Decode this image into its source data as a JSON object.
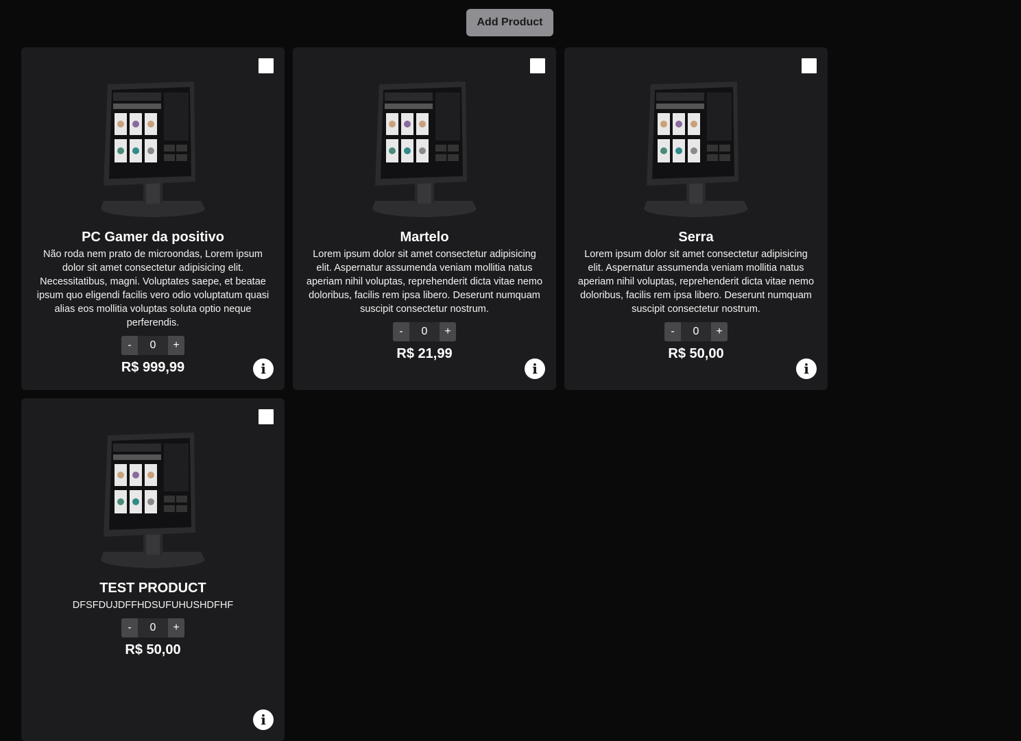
{
  "toolbar": {
    "add_label": "Add Product"
  },
  "products": [
    {
      "name": "PC Gamer da positivo",
      "description": "Não roda nem prato de microondas, Lorem ipsum dolor sit amet consectetur adipisicing elit. Necessitatibus, magni. Voluptates saepe, et beatae ipsum quo eligendi facilis vero odio voluptatum quasi alias eos mollitia voluptas soluta optio neque perferendis.",
      "quantity": "0",
      "price": "R$ 999,99",
      "minus": "-",
      "plus": "+",
      "info": "i"
    },
    {
      "name": "Martelo",
      "description": "Lorem ipsum dolor sit amet consectetur adipisicing elit. Aspernatur assumenda veniam mollitia natus aperiam nihil voluptas, reprehenderit dicta vitae nemo doloribus, facilis rem ipsa libero. Deserunt numquam suscipit consectetur nostrum.",
      "quantity": "0",
      "price": "R$ 21,99",
      "minus": "-",
      "plus": "+",
      "info": "i"
    },
    {
      "name": "Serra",
      "description": "Lorem ipsum dolor sit amet consectetur adipisicing elit. Aspernatur assumenda veniam mollitia natus aperiam nihil voluptas, reprehenderit dicta vitae nemo doloribus, facilis rem ipsa libero. Deserunt numquam suscipit consectetur nostrum.",
      "quantity": "0",
      "price": "R$ 50,00",
      "minus": "-",
      "plus": "+",
      "info": "i"
    },
    {
      "name": "TEST PRODUCT",
      "description": "DFSFDUJDFFHDSUFUHUSHDFHF",
      "quantity": "0",
      "price": "R$ 50,00",
      "minus": "-",
      "plus": "+",
      "info": "i"
    }
  ],
  "colors": {
    "page_bg": "#0a0a0a",
    "card_bg": "#1c1c1e",
    "button_bg": "#8e8e93"
  }
}
